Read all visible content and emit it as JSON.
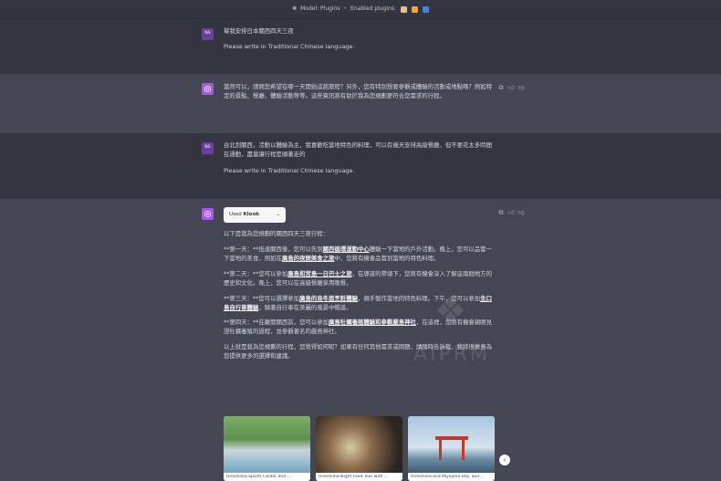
{
  "topbar": {
    "model": "Model: Plugins",
    "sep": "•",
    "enabled": "Enabled plugins:"
  },
  "plugins": [
    {
      "icon": "plugin-icon-1",
      "color": "#e6c08a"
    },
    {
      "icon": "plugin-icon-2",
      "color": "#f5a623"
    },
    {
      "icon": "plugin-icon-3",
      "color": "#3b82f6"
    }
  ],
  "messages": {
    "m1": {
      "avatar": "NS",
      "line1": "幫我安排日本關西四天三夜",
      "line2": "Please write in Traditional Chinese language."
    },
    "m2": {
      "text": "當然可以，請問您希望在哪一天開始這趟旅程？另外，您有特別想要參觀或體驗的活動或地點嗎？例如特定的景點、餐廳、體驗活動等等。這些資訊將有助於我為您規劃更符合您需求的行程。"
    },
    "m3": {
      "avatar": "NS",
      "line1": "台北到關西，活動以體驗為主，我喜歡吃當地特色的料理，可以有幾天安排高級餐廳，但不要花太多時間在通勤，盡量讓行程是順著走的",
      "line2": "Please write in Traditional Chinese language."
    },
    "m4": {
      "used_prefix": "Used ",
      "used_name": "Klook",
      "intro": "以下是我為您規劃的關西四天三夜行程：",
      "day1_a": "**第一天：**抵達關西後，您可以先到",
      "day1_l1": "關西循環運動中心",
      "day1_b": "體驗一下當地的戶外活動。晚上，您可以品嘗一下當地的美食，例如在",
      "day1_l2": "廣島的夜間美食之旅",
      "day1_c": "中，您將有機會品嘗到當地的特色料理。",
      "day2_a": "**第二天：**您可以參加",
      "day2_l1": "廣島和宮島一日巴士之旅",
      "day2_b": "，在導遊的帶領下，您將有機會深入了解這兩個地方的歷史和文化。晚上，您可以在高級餐廳享用晚餐。",
      "day3_a": "**第三天：**您可以選擇參加",
      "day3_l1": "廣島的烏冬面烹飪體驗",
      "day3_b": "，親手製作當地的特色料理。下午，您可以參加",
      "day3_l2": "生口島自行車體驗",
      "day3_c": "，騎著自行車在美麗的風景中暢遊。",
      "day4_a": "**第四天：**在離開關西前，您可以參加",
      "day4_l1": "廣島牡蠣養殖體驗和參觀嚴島神社",
      "day4_b": "，在這裡，您將有機會親眼見證牡蠣養殖的過程，並參觀著名的嚴島神社。",
      "outro": "以上就是我為您規劃的行程，您覺得如何呢？如果有任何其他需求或問題，請隨時告訴我，我將很樂意為您提供更多的選擇和建議。"
    }
  },
  "cards": [
    {
      "caption": "Hiroshima Sports Center and ..."
    },
    {
      "caption": "Hiroshima Night Food Tour with ..."
    },
    {
      "caption": "Hiroshima and Miyajima Day Tour ..."
    }
  ],
  "watermark": "AIPRM",
  "colors": {
    "bg": "#343541",
    "bot_bg": "#444654",
    "accent": "#a855f7"
  }
}
